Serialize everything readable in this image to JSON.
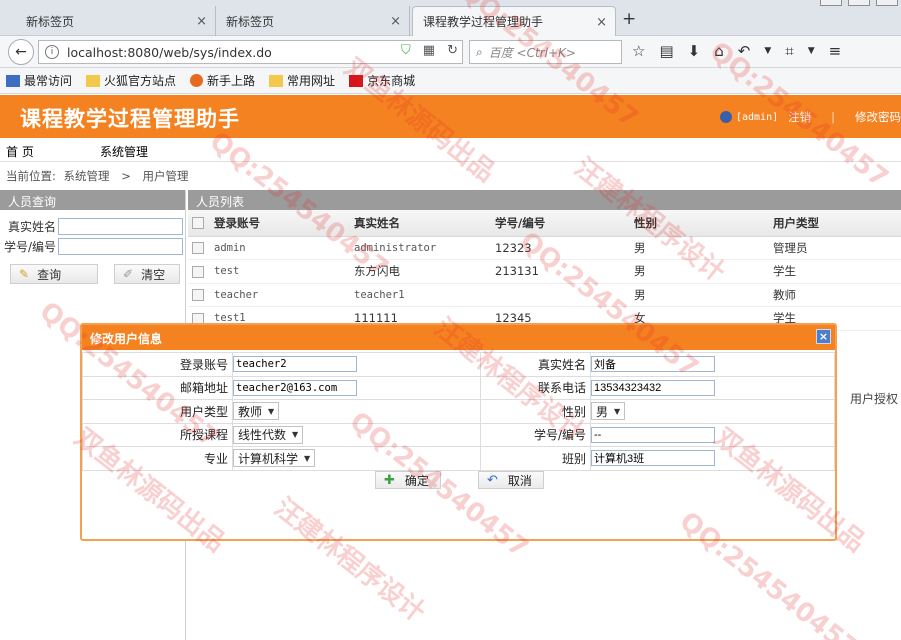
{
  "browser": {
    "tabs": [
      {
        "label": "新标签页",
        "close": "×"
      },
      {
        "label": "新标签页",
        "close": "×"
      },
      {
        "label": "课程教学过程管理助手",
        "close": "×"
      }
    ],
    "new_tab": "+",
    "url": "localhost:8080/web/sys/index.do",
    "search_placeholder": "百度 <Ctrl+K>",
    "bookmarks": [
      "最常访问",
      "火狐官方站点",
      "新手上路",
      "常用网址",
      "京东商城"
    ]
  },
  "app": {
    "title": "课程教学过程管理助手",
    "user": "[admin]",
    "logout": "注销",
    "separator": "|",
    "change_password": "修改密码"
  },
  "menu": {
    "home": "首 页",
    "system": "系统管理"
  },
  "breadcrumb": {
    "label": "当前位置:",
    "path1": "系统管理",
    "arrow": ">",
    "path2": "用户管理"
  },
  "search_panel": {
    "title": "人员查询",
    "real_name_label": "真实姓名",
    "student_no_label": "学号/编号",
    "query_button": "查询",
    "clear_button": "清空"
  },
  "list_panel": {
    "title": "人员列表",
    "columns": [
      "登录账号",
      "真实姓名",
      "学号/编号",
      "性别",
      "用户类型"
    ],
    "rows": [
      {
        "account": "admin",
        "name": "administrator",
        "number": "12323",
        "gender": "男",
        "type": "管理员"
      },
      {
        "account": "test",
        "name": "东方闪电",
        "number": "213131",
        "gender": "男",
        "type": "学生"
      },
      {
        "account": "teacher",
        "name": "teacher1",
        "number": "",
        "gender": "男",
        "type": "教师"
      },
      {
        "account": "test1",
        "name": "111111",
        "number": "12345",
        "gender": "女",
        "type": "学生"
      }
    ],
    "auth_link": "用户授权"
  },
  "modal": {
    "title": "修改用户信息",
    "close": "×",
    "labels": {
      "account": "登录账号",
      "real_name": "真实姓名",
      "email": "邮箱地址",
      "phone": "联系电话",
      "user_type": "用户类型",
      "gender": "性别",
      "course": "所授课程",
      "student_no": "学号/编号",
      "major": "专业",
      "class": "班别"
    },
    "values": {
      "account": "teacher2",
      "real_name": "刘备",
      "email": "teacher2@163.com",
      "phone": "13534323432",
      "user_type": "教师",
      "gender": "男",
      "course": "线性代数",
      "student_no": "--",
      "major": "计算机科学",
      "class": "计算机3班"
    },
    "confirm_button": "确定",
    "cancel_button": "取消"
  },
  "watermarks": [
    "QQ:254540457",
    "双鱼林源码出品",
    "汪建林程序设计"
  ],
  "colors": {
    "header_orange": "#f58220",
    "panel_gray": "#9b9b9b",
    "close_blue": "#4d7fc8"
  }
}
